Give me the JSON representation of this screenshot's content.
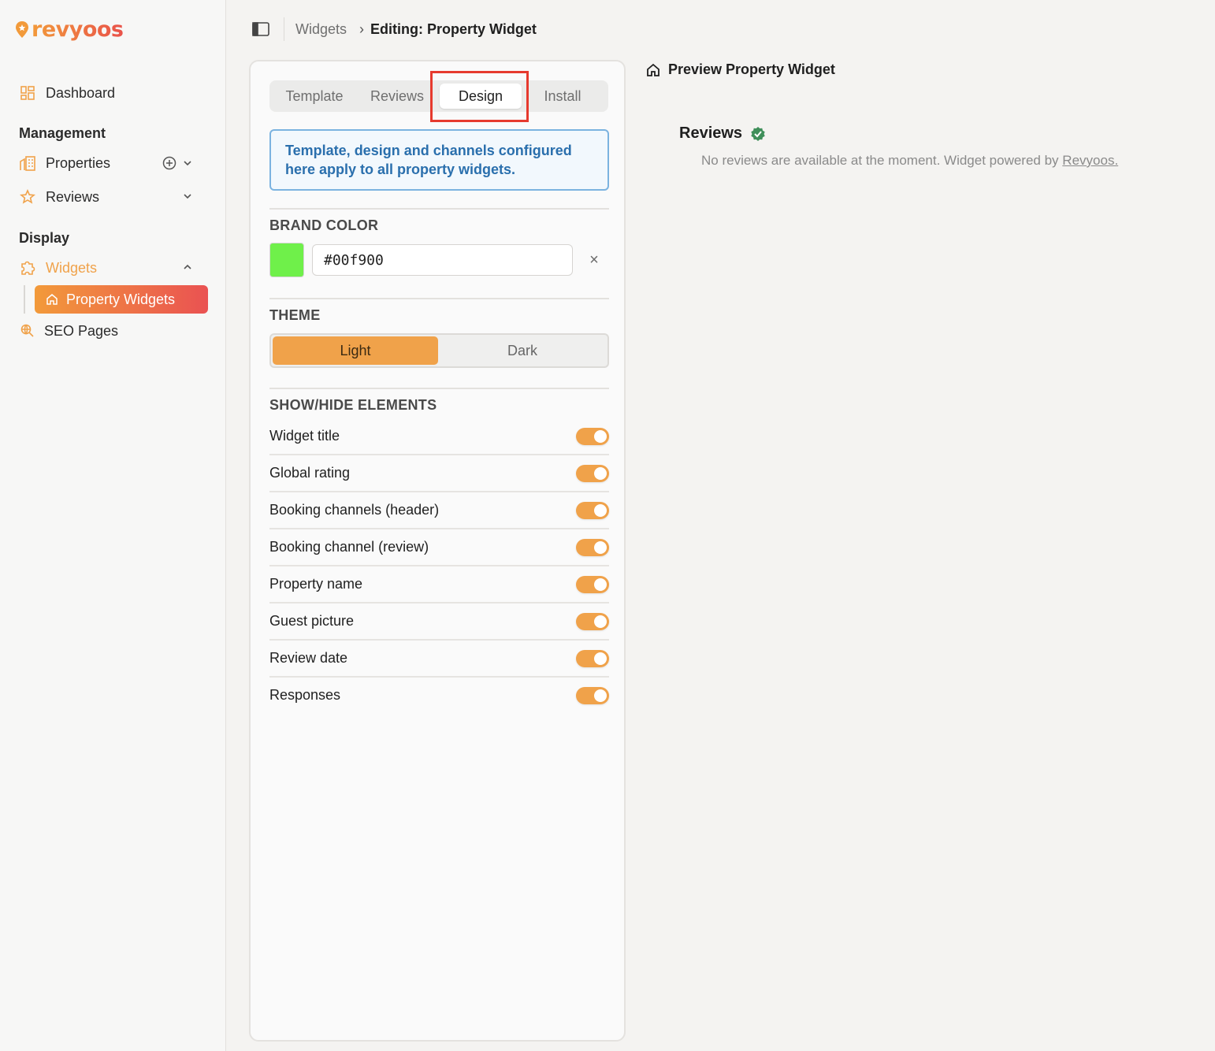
{
  "brand": {
    "name": "revyoos"
  },
  "sidebar": {
    "dashboard": "Dashboard",
    "management_title": "Management",
    "properties": "Properties",
    "reviews": "Reviews",
    "display_title": "Display",
    "widgets": "Widgets",
    "property_widgets": "Property Widgets",
    "seo_pages": "SEO Pages"
  },
  "breadcrumb": {
    "parent": "Widgets",
    "separator": "›",
    "current": "Editing: Property Widget"
  },
  "tabs": [
    {
      "label": "Template"
    },
    {
      "label": "Reviews"
    },
    {
      "label": "Design",
      "active": true
    },
    {
      "label": "Install"
    }
  ],
  "info_message": "Template, design and channels configured here apply to all property widgets.",
  "brand_color": {
    "label": "BRAND COLOR",
    "value": "#00f900",
    "swatch": "#6ff04a",
    "clear": "×"
  },
  "theme": {
    "label": "THEME",
    "options": [
      "Light",
      "Dark"
    ],
    "selected": "Light"
  },
  "show_hide": {
    "label": "SHOW/HIDE ELEMENTS",
    "items": [
      {
        "label": "Widget title",
        "on": true
      },
      {
        "label": "Global rating",
        "on": true
      },
      {
        "label": "Booking channels (header)",
        "on": true
      },
      {
        "label": "Booking channel (review)",
        "on": true
      },
      {
        "label": "Property name",
        "on": true
      },
      {
        "label": "Guest picture",
        "on": true
      },
      {
        "label": "Review date",
        "on": true
      },
      {
        "label": "Responses",
        "on": true
      }
    ]
  },
  "preview": {
    "title": "Preview Property Widget",
    "reviews_heading": "Reviews",
    "empty_text": "No reviews are available at the moment. Widget powered by",
    "powered_link": "Revyoos."
  },
  "colors": {
    "accent": "#f0a24a",
    "accent_red": "#ea5252",
    "highlight_box": "#e63a2e",
    "info_blue": "#2a6fad"
  }
}
